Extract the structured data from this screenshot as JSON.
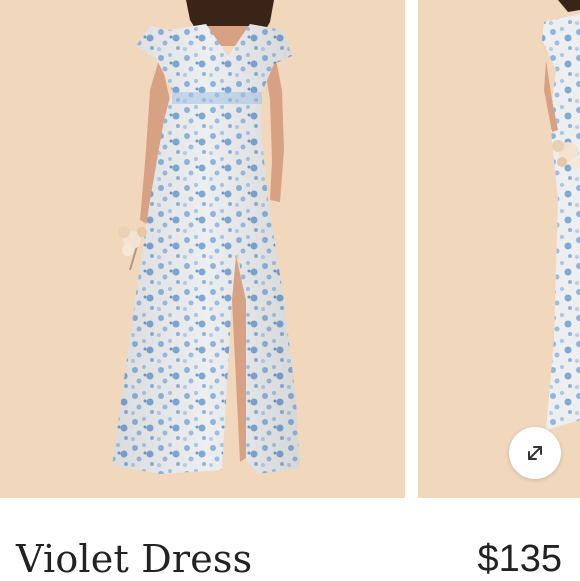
{
  "product": {
    "name": "Violet Dress",
    "price": "$135"
  },
  "gallery": {
    "icons": {
      "expand": "expand-arrows-icon"
    },
    "colors": {
      "backdrop": "#f1d8bd",
      "dress_base": "#e9ecef",
      "dress_print": "#8fb4dd"
    }
  }
}
